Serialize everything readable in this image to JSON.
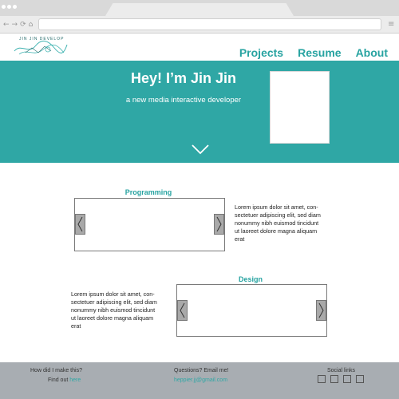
{
  "browser": {
    "url": "",
    "nav_icons": [
      "←",
      "→",
      "⟳",
      "⌂"
    ],
    "menu_icon": "≡"
  },
  "header": {
    "logo_text": "JIN JIN DEVELOP",
    "nav": [
      {
        "label": "Projects"
      },
      {
        "label": "Resume"
      },
      {
        "label": "About"
      }
    ]
  },
  "hero": {
    "title": "Hey! I’m Jin Jin",
    "subtitle": "a new media interactive developer"
  },
  "sections": [
    {
      "title": "Programming",
      "lines": [
        "Lorem ipsum dolor sit amet, con-",
        "sectetuer adipiscing elit, sed diam",
        "nonummy nibh euismod tincidunt",
        "ut laoreet dolore magna aliquam",
        "erat"
      ]
    },
    {
      "title": "Design",
      "lines": [
        "Lorem ipsum dolor sit amet, con-",
        "sectetuer adipiscing elit, sed diam",
        "nonummy nibh euismod tincidunt",
        "ut laoreet dolore magna aliquam",
        "erat"
      ]
    }
  ],
  "footer": {
    "col1_line1": "How did I make this?",
    "col1_line2_prefix": "Find out ",
    "col1_link": "here",
    "col2_line1": "Questions? Email me!",
    "col2_link": "heppier.jj@gmail.com",
    "col3_title": "Social links"
  },
  "colors": {
    "accent": "#2fa7a5",
    "footer_bg": "#a8adb2"
  }
}
